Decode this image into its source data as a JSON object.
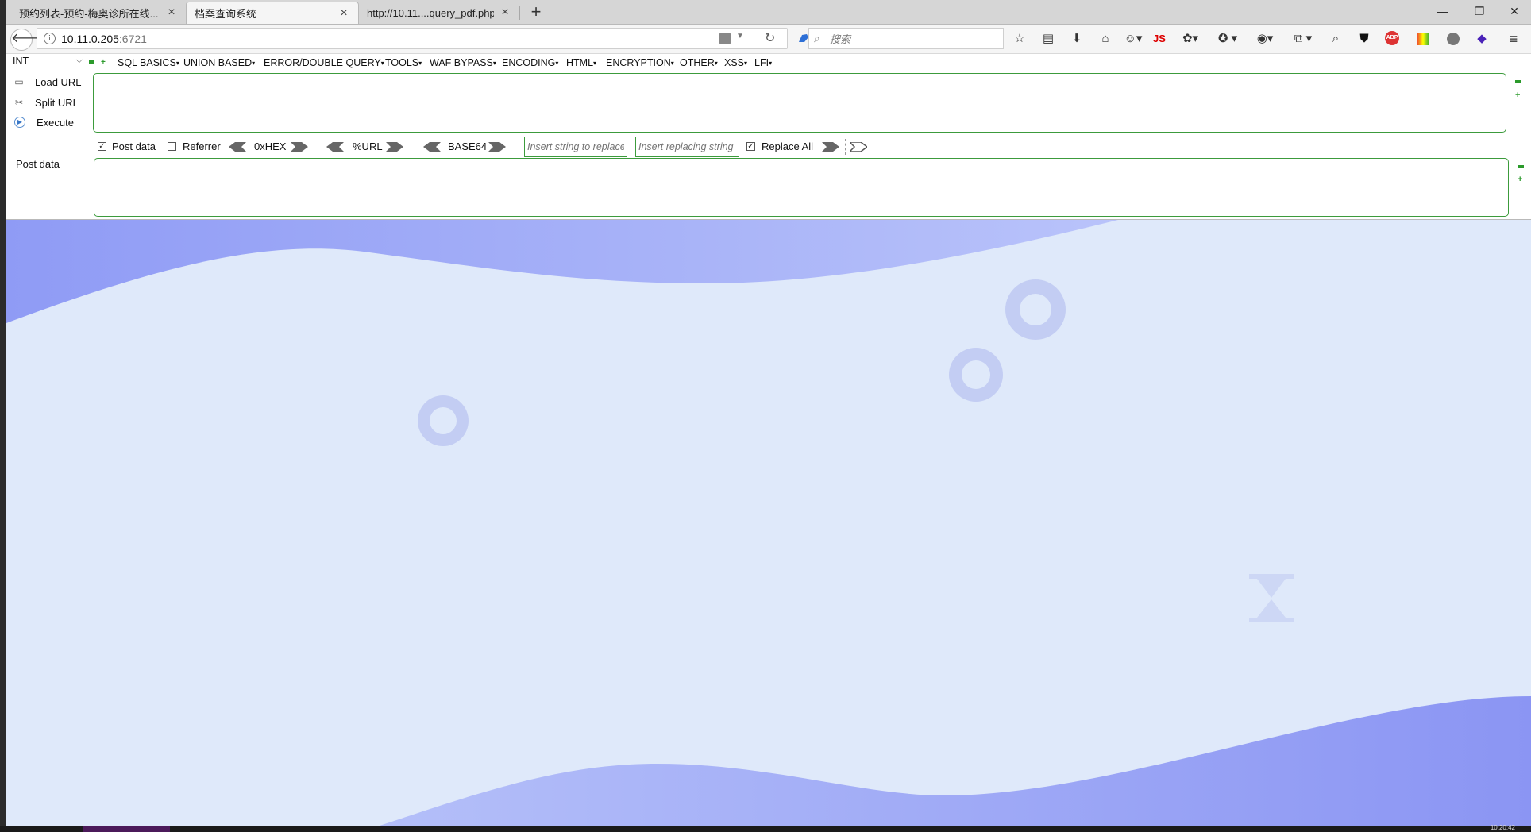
{
  "browser": {
    "tabs": [
      {
        "label": "预约列表-预约-梅奥诊所在线...",
        "active": false
      },
      {
        "label": "档案查询系统",
        "active": true
      },
      {
        "label": "http://10.11....query_pdf.php",
        "active": false
      }
    ],
    "new_tab": "+",
    "window_controls": {
      "minimize": "—",
      "restore": "❐",
      "close": "✕"
    },
    "url_host": "10.11.0.205",
    "url_port": ":6721",
    "search_placeholder": "搜索",
    "toolbar_js_label": "JS",
    "toolbar_abp_label": "ABP"
  },
  "hackbar": {
    "int_select": "INT",
    "menus": [
      {
        "label": "SQL BASICS"
      },
      {
        "label": "UNION BASED"
      },
      {
        "label": "ERROR/DOUBLE QUERY"
      },
      {
        "label": "TOOLS"
      },
      {
        "label": "WAF BYPASS"
      },
      {
        "label": "ENCODING"
      },
      {
        "label": "HTML"
      },
      {
        "label": "ENCRYPTION"
      },
      {
        "label": "OTHER"
      },
      {
        "label": "XSS"
      },
      {
        "label": "LFI"
      }
    ],
    "load_url": "Load URL",
    "split_url": "Split URL",
    "execute": "Execute",
    "url_value": "",
    "options": {
      "post_data_label": "Post data",
      "post_data_checked": true,
      "referrer_label": "Referrer",
      "referrer_checked": false,
      "hex_label": "0xHEX",
      "url_label": "%URL",
      "base64_label": "BASE64",
      "replace_from_placeholder": "Insert string to replace",
      "replace_to_placeholder": "Insert replacing string",
      "replace_all_label": "Replace All",
      "replace_all_checked": true
    },
    "post_data_label": "Post data",
    "post_data_value": ""
  },
  "colors": {
    "page_bg": "#dfe9fa",
    "wave": "#8f9bf5",
    "hackbar_border": "#3c9b3c"
  },
  "taskbar": {
    "clock": "10:20:42"
  }
}
